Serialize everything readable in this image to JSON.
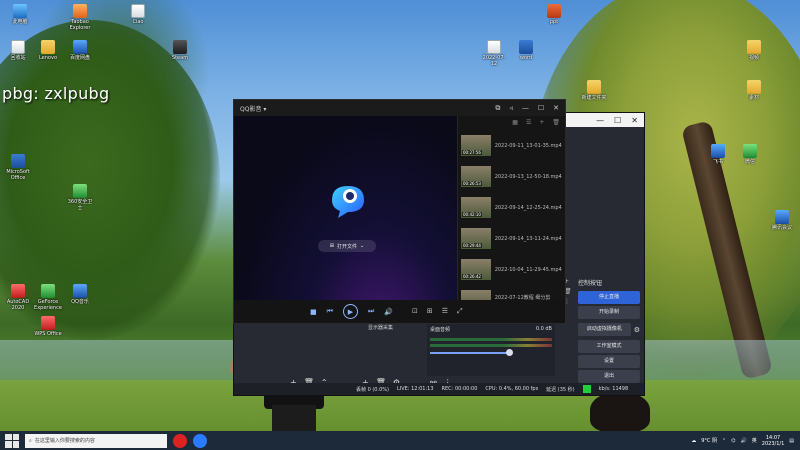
{
  "overlay_text": "pbg:  zxlpubg",
  "desktop_icons": [
    {
      "label": "此电脑",
      "glyph": "pc"
    },
    {
      "label": "Taobao Explorer",
      "glyph": "orange"
    },
    {
      "label": "Ciao",
      "glyph": "file"
    },
    {
      "label": "MicroSoft Office",
      "glyph": "word"
    },
    {
      "label": "AutoCAD 2020",
      "glyph": "red"
    },
    {
      "label": "WPS Office",
      "glyph": "red"
    },
    {
      "label": "GeForce Experience",
      "glyph": "green"
    },
    {
      "label": "QQ音乐",
      "glyph": "blue"
    },
    {
      "label": "Steam",
      "glyph": "dark"
    },
    {
      "label": "2022-07-12",
      "glyph": "file"
    },
    {
      "label": "Lenovo",
      "glyph": "folder"
    },
    {
      "label": "word",
      "glyph": "word"
    },
    {
      "label": "ppt",
      "glyph": "ppt"
    },
    {
      "label": "视频",
      "glyph": "folder"
    },
    {
      "label": "素材",
      "glyph": "folder"
    },
    {
      "label": "新建文件夹",
      "glyph": "folder"
    },
    {
      "label": "回收站",
      "glyph": "file"
    },
    {
      "label": "百度网盘",
      "glyph": "blue"
    },
    {
      "label": "360安全卫士",
      "glyph": "green"
    },
    {
      "label": "微信",
      "glyph": "green"
    },
    {
      "label": "飞书",
      "glyph": "blue"
    },
    {
      "label": "腾讯会议",
      "glyph": "blue"
    }
  ],
  "qq_player": {
    "title": "QQ影音 ▾",
    "open_file_label": "打开文件",
    "playlist": [
      {
        "duration": "00:27:56",
        "name": "2022-09-11_13-01-35.mp4"
      },
      {
        "duration": "00:26:53",
        "name": "2022-09-13_12-50-18.mp4"
      },
      {
        "duration": "00:42:10",
        "name": "2022-09-14_12-25-24.mp4"
      },
      {
        "duration": "00:29:44",
        "name": "2022-09-14_13-11-24.mp4"
      },
      {
        "duration": "00:26:42",
        "name": "2022-10-04_11-29-45.mp4"
      },
      {
        "duration": "00:08:48",
        "name": "2022-07-12教程 细分剪辑.mp4"
      }
    ]
  },
  "obs": {
    "controls_title": "控制按钮",
    "buttons": {
      "stop_streaming": "停止直播",
      "start_recording": "开始录制",
      "start_virtual_cam": "启动虚拟摄像机",
      "studio_mode": "工作室模式",
      "settings": "设置",
      "exit": "退出"
    },
    "mixer": {
      "label": "桌面音频",
      "db": "0.0 dB"
    },
    "sources_label": "显示器采集",
    "status": {
      "dropped_frames": "丢帧 0 (0.0%)",
      "live": "LIVE: 12:01:13",
      "rec": "REC: 00:00:00",
      "cpu": "CPU: 0.4%, 60.00 fps",
      "delay": "延迟 (35 秒)",
      "bitrate": "kb/s: 11498"
    }
  },
  "taskbar": {
    "search_placeholder": "在这里输入你要搜索的内容",
    "weather": "9°C 阴",
    "lang": "英",
    "time": "14:07",
    "date": "2023/1/1"
  },
  "colors": {
    "obs_primary": "#2f63d8",
    "status_green": "#1dd13a",
    "qq_accent": "#8fb4ff"
  }
}
